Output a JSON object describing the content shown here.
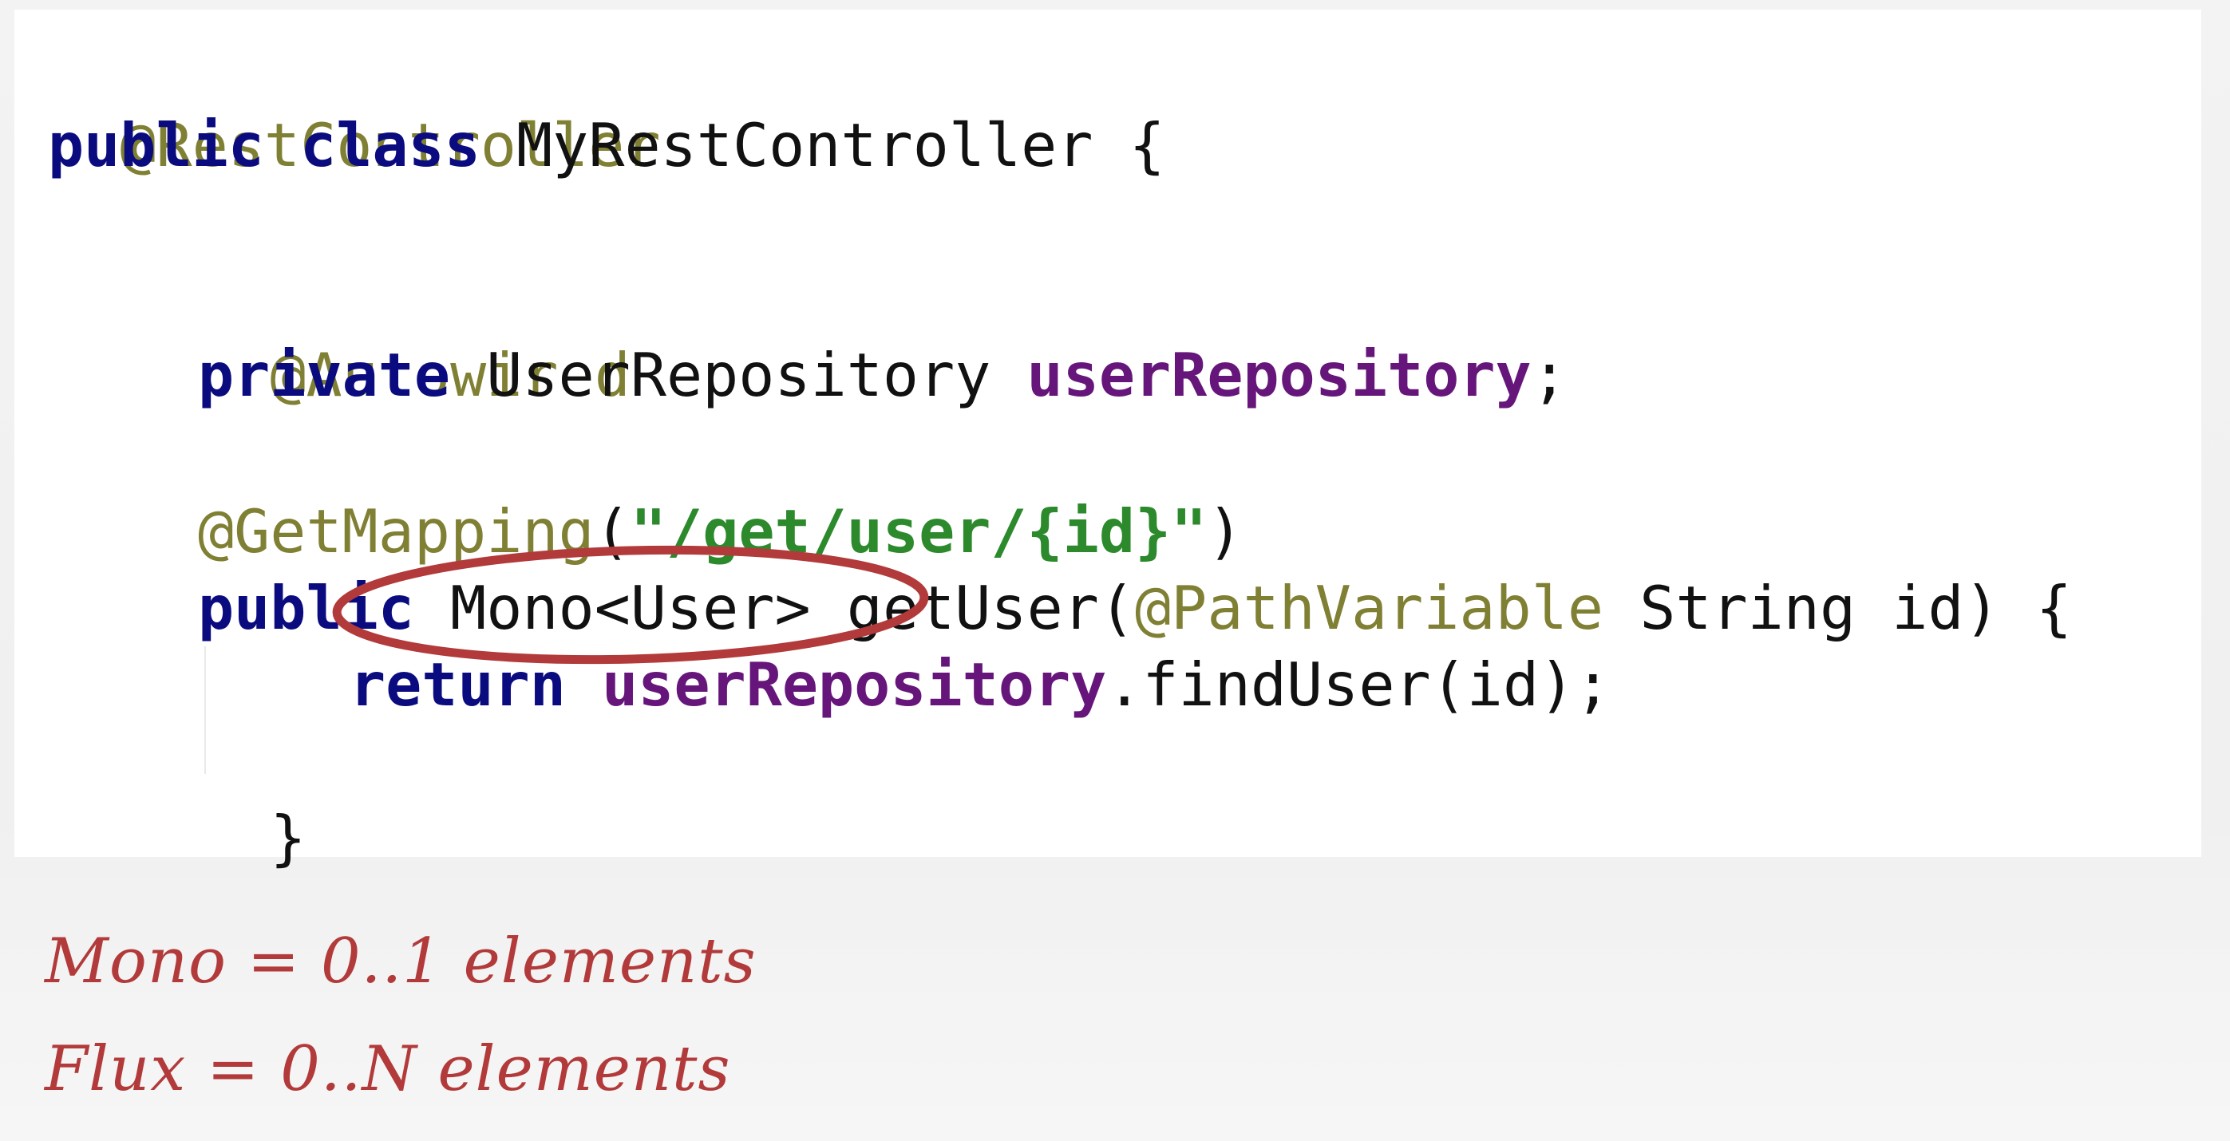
{
  "code": {
    "line1": {
      "annotation": "@RestController"
    },
    "line2": {
      "kw1": "public",
      "kw2": "class",
      "name": "MyRestController",
      "brace": "{"
    },
    "line4": {
      "annotation": "@Autowired"
    },
    "line5": {
      "kw": "private",
      "type": "UserRepository",
      "field": "userRepository",
      "semi": ";"
    },
    "line7": {
      "annotation": "@GetMapping",
      "open": "(",
      "string": "\"/get/user/{id}\"",
      "close": ")"
    },
    "line8": {
      "kw": "public",
      "return_type": "Mono<User>",
      "method": "getUser(",
      "param_annotation": "@PathVariable",
      "param": "String id) {"
    },
    "line9": {
      "kw": "return",
      "field": "userRepository",
      "call": ".findUser(id);"
    },
    "line10": {
      "brace": "}"
    }
  },
  "notes": {
    "mono": "Mono = 0..1 elements",
    "flux": "Flux = 0..N elements"
  },
  "colors": {
    "keyword": "#0b0b80",
    "annotation": "#808034",
    "field": "#66167a",
    "string": "#2c8a2c",
    "highlight_ellipse": "#b23a3a",
    "handwriting": "#b23a3a"
  }
}
